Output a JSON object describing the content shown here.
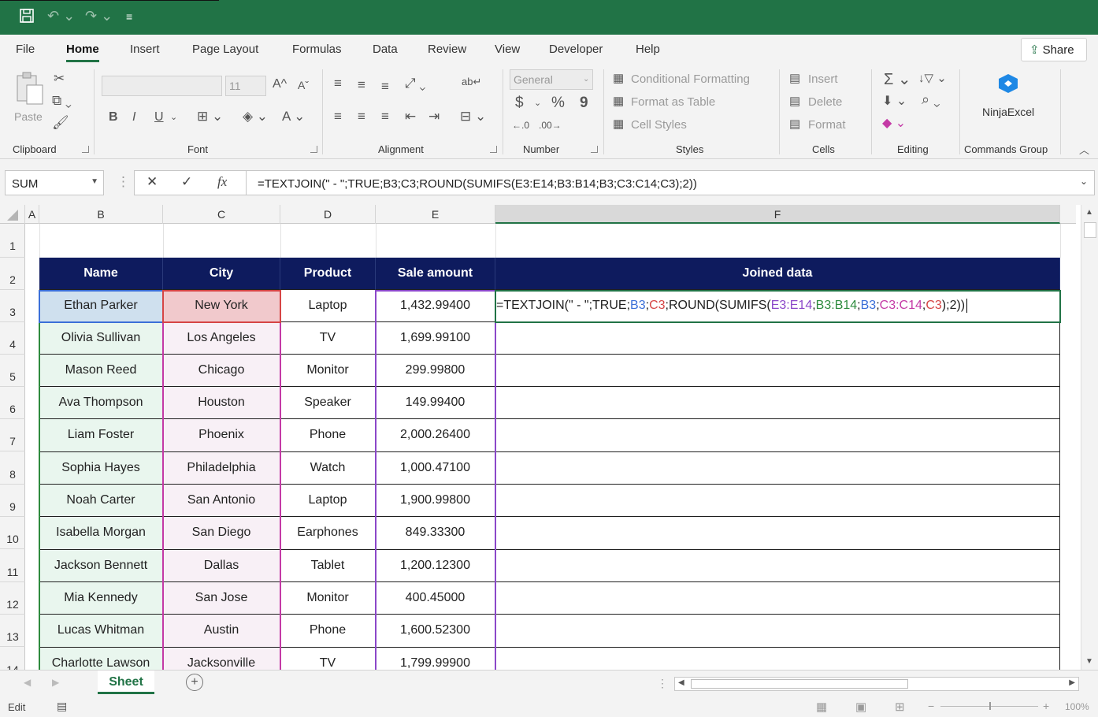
{
  "qat": {
    "save_icon": "save-icon",
    "undo_icon": "undo-icon",
    "redo_icon": "redo-icon",
    "customize_icon": "customize-icon"
  },
  "ribbon_tabs": [
    "File",
    "Home",
    "Insert",
    "Page Layout",
    "Formulas",
    "Data",
    "Review",
    "View",
    "Developer",
    "Help"
  ],
  "active_tab": "Home",
  "share_label": "Share",
  "ribbon": {
    "clipboard": {
      "label": "Clipboard",
      "paste": "Paste"
    },
    "font": {
      "label": "Font",
      "font_size": "11",
      "bold": "B",
      "italic": "I",
      "underline": "U"
    },
    "alignment": {
      "label": "Alignment"
    },
    "number": {
      "label": "Number",
      "format": "General",
      "currency": "$",
      "percent": "%",
      "comma": "9"
    },
    "styles": {
      "label": "Styles",
      "conditional": "Conditional Formatting",
      "format_table": "Format as Table",
      "cell_styles": "Cell Styles"
    },
    "cells": {
      "label": "Cells",
      "insert": "Insert",
      "delete": "Delete",
      "format": "Format"
    },
    "editing": {
      "label": "Editing"
    },
    "commands": {
      "label": "Commands Group",
      "ninja": "NinjaExcel"
    }
  },
  "formula_bar": {
    "name_box": "SUM",
    "formula": "=TEXTJOIN(\" - \";TRUE;B3;C3;ROUND(SUMIFS(E3:E14;B3:B14;B3;C3:C14;C3);2))"
  },
  "columns": [
    "A",
    "B",
    "C",
    "D",
    "E",
    "F"
  ],
  "rows": [
    "1",
    "2",
    "3",
    "4",
    "5",
    "6",
    "7",
    "8",
    "9",
    "10",
    "11",
    "12",
    "13",
    "14"
  ],
  "table": {
    "headers": [
      "Name",
      "City",
      "Product",
      "Sale amount",
      "Joined data"
    ],
    "rows": [
      [
        "Ethan Parker",
        "New York",
        "Laptop",
        "1,432.99400"
      ],
      [
        "Olivia Sullivan",
        "Los Angeles",
        "TV",
        "1,699.99100"
      ],
      [
        "Mason Reed",
        "Chicago",
        "Monitor",
        "299.99800"
      ],
      [
        "Ava Thompson",
        "Houston",
        "Speaker",
        "149.99400"
      ],
      [
        "Liam Foster",
        "Phoenix",
        "Phone",
        "2,000.26400"
      ],
      [
        "Sophia Hayes",
        "Philadelphia",
        "Watch",
        "1,000.47100"
      ],
      [
        "Noah Carter",
        "San Antonio",
        "Laptop",
        "1,900.99800"
      ],
      [
        "Isabella Morgan",
        "San Diego",
        "Earphones",
        "849.33300"
      ],
      [
        "Jackson Bennett",
        "Dallas",
        "Tablet",
        "1,200.12300"
      ],
      [
        "Mia Kennedy",
        "San Jose",
        "Monitor",
        "400.45000"
      ],
      [
        "Lucas Whitman",
        "Austin",
        "Phone",
        "1,600.52300"
      ],
      [
        "Charlotte Lawson",
        "Jacksonville",
        "TV",
        "1,799.99900"
      ]
    ],
    "edit_formula_parts": [
      {
        "t": "=TEXTJOIN(\" - \";TRUE;",
        "c": "#222222"
      },
      {
        "t": "B3",
        "c": "#3b6fd8"
      },
      {
        "t": ";",
        "c": "#222222"
      },
      {
        "t": "C3",
        "c": "#d64545"
      },
      {
        "t": ";ROUND(SUMIFS(",
        "c": "#222222"
      },
      {
        "t": "E3:E14",
        "c": "#8b47c9"
      },
      {
        "t": ";",
        "c": "#222222"
      },
      {
        "t": "B3:B14",
        "c": "#2e8b3e"
      },
      {
        "t": ";",
        "c": "#222222"
      },
      {
        "t": "B3",
        "c": "#3b6fd8"
      },
      {
        "t": ";",
        "c": "#222222"
      },
      {
        "t": "C3:C14",
        "c": "#c43aa6"
      },
      {
        "t": ";",
        "c": "#222222"
      },
      {
        "t": "C3",
        "c": "#d64545"
      },
      {
        "t": ");2))",
        "c": "#222222"
      }
    ]
  },
  "sheet_tab": "Sheet",
  "status": {
    "mode": "Edit",
    "zoom": "100%"
  },
  "colors": {
    "excel_green": "#217346",
    "header_navy": "#0e1b5e",
    "name_ref": "#3b6fd8",
    "city_ref": "#d64545",
    "sale_ref": "#8b47c9"
  }
}
